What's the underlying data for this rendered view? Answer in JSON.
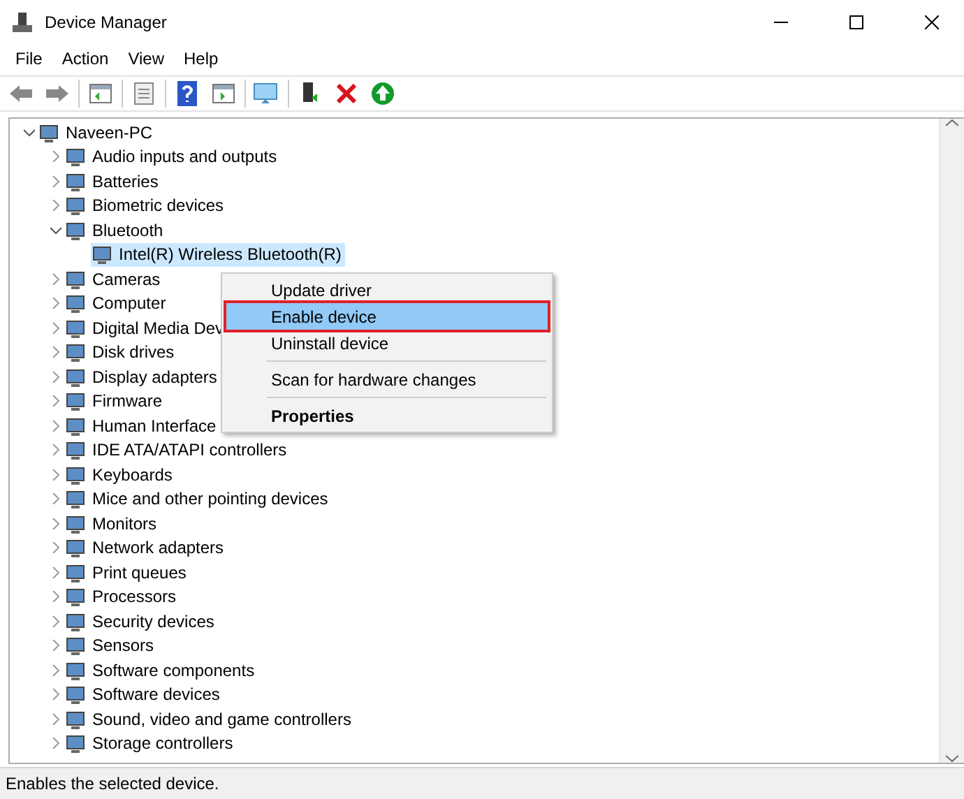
{
  "window": {
    "title": "Device Manager"
  },
  "menu": [
    "File",
    "Action",
    "View",
    "Help"
  ],
  "tree": [
    {
      "label": "Naveen-PC",
      "expanded": true,
      "selected": false,
      "children": [
        {
          "label": "Audio inputs and outputs",
          "expanded": false,
          "selected": false
        },
        {
          "label": "Batteries",
          "expanded": false,
          "selected": false
        },
        {
          "label": "Biometric devices",
          "expanded": false,
          "selected": false
        },
        {
          "label": "Bluetooth",
          "expanded": true,
          "selected": false,
          "children": [
            {
              "label": "Intel(R) Wireless Bluetooth(R)",
              "selected": true
            }
          ]
        },
        {
          "label": "Cameras",
          "expanded": false,
          "selected": false
        },
        {
          "label": "Computer",
          "expanded": false,
          "selected": false
        },
        {
          "label": "Digital Media Dev",
          "expanded": false,
          "selected": false
        },
        {
          "label": "Disk drives",
          "expanded": false,
          "selected": false
        },
        {
          "label": "Display adapters",
          "expanded": false,
          "selected": false
        },
        {
          "label": "Firmware",
          "expanded": false,
          "selected": false
        },
        {
          "label": "Human Interface",
          "expanded": false,
          "selected": false
        },
        {
          "label": "IDE ATA/ATAPI controllers",
          "expanded": false,
          "selected": false
        },
        {
          "label": "Keyboards",
          "expanded": false,
          "selected": false
        },
        {
          "label": "Mice and other pointing devices",
          "expanded": false,
          "selected": false
        },
        {
          "label": "Monitors",
          "expanded": false,
          "selected": false
        },
        {
          "label": "Network adapters",
          "expanded": false,
          "selected": false
        },
        {
          "label": "Print queues",
          "expanded": false,
          "selected": false
        },
        {
          "label": "Processors",
          "expanded": false,
          "selected": false
        },
        {
          "label": "Security devices",
          "expanded": false,
          "selected": false
        },
        {
          "label": "Sensors",
          "expanded": false,
          "selected": false
        },
        {
          "label": "Software components",
          "expanded": false,
          "selected": false
        },
        {
          "label": "Software devices",
          "expanded": false,
          "selected": false
        },
        {
          "label": "Sound, video and game controllers",
          "expanded": false,
          "selected": false
        },
        {
          "label": "Storage controllers",
          "expanded": false,
          "selected": false
        }
      ]
    }
  ],
  "context_menu": [
    {
      "kind": "item",
      "label": "Update driver",
      "selected": false,
      "default": false
    },
    {
      "kind": "item",
      "label": "Enable device",
      "selected": true,
      "default": false
    },
    {
      "kind": "item",
      "label": "Uninstall device",
      "selected": false,
      "default": false
    },
    {
      "kind": "separator"
    },
    {
      "kind": "item",
      "label": "Scan for hardware changes",
      "selected": false,
      "default": false
    },
    {
      "kind": "separator"
    },
    {
      "kind": "item",
      "label": "Properties",
      "selected": false,
      "default": true
    }
  ],
  "status_bar": "Enables the selected device."
}
